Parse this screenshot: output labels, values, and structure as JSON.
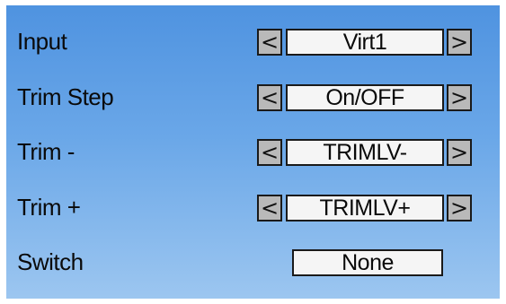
{
  "rows": [
    {
      "label": "Input",
      "value": "Virt1",
      "prev": "<",
      "next": ">"
    },
    {
      "label": "Trim Step",
      "value": "On/OFF",
      "prev": "<",
      "next": ">"
    },
    {
      "label": "Trim -",
      "value": "TRIMLV-",
      "prev": "<",
      "next": ">"
    },
    {
      "label": "Trim +",
      "value": "TRIMLV+",
      "prev": "<",
      "next": ">"
    },
    {
      "label": "Switch",
      "value": "None"
    }
  ],
  "colors": {
    "background_top": "#4f93e0",
    "background_bottom": "#9cc6f0",
    "arrow_button": "#b9b9b9",
    "value_box": "#f5f5f5",
    "text": "#0a0a0a"
  }
}
